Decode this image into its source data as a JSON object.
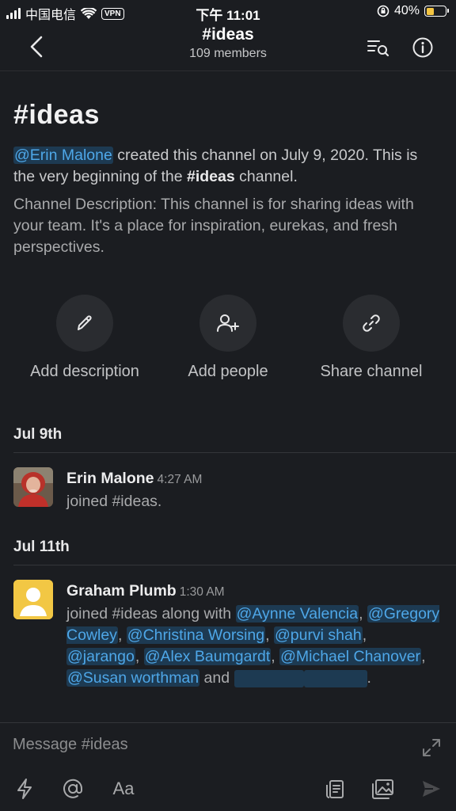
{
  "status_bar": {
    "carrier": "中国电信",
    "vpn": "VPN",
    "time": "下午 11:01",
    "battery": "40%",
    "battery_level": 0.4
  },
  "header": {
    "title": "#ideas",
    "members": "109 members"
  },
  "intro": {
    "title": "#ideas",
    "creator_mention": "@Erin Malone",
    "created_text": " created this channel on July 9, 2020. This is the very beginning of the ",
    "channel_bold": "#ideas",
    "channel_suffix": " channel.",
    "description": "Channel Description: This channel is for sharing ideas with your team. It's a place for inspiration, eurekas, and fresh perspectives."
  },
  "actions": [
    {
      "label": "Add description",
      "icon": "pencil-icon"
    },
    {
      "label": "Add people",
      "icon": "add-person-icon"
    },
    {
      "label": "Share channel",
      "icon": "link-icon"
    }
  ],
  "dates": [
    "Jul 9th",
    "Jul 11th"
  ],
  "messages": [
    {
      "name": "Erin Malone",
      "time": "4:27 AM",
      "text": "joined #ideas."
    },
    {
      "name": "Graham Plumb",
      "time": "1:30 AM",
      "text_prefix": "joined #ideas along with ",
      "mentions": [
        "@Aynne Valencia",
        "@Gregory Cowley",
        "@Christina Worsing",
        "@purvi shah",
        "@jarango",
        "@Alex Baumgardt",
        "@Michael Chanover",
        "@Susan worthman"
      ],
      "sep": ", ",
      "and": " and ",
      "end": "."
    }
  ],
  "composer": {
    "placeholder": "Message #ideas",
    "format_label": "Aa"
  },
  "colors": {
    "background": "#1b1d21",
    "mention_bg": "#1d3a52",
    "mention_text": "#4ea7e8",
    "battery_fill": "#f4c542"
  }
}
